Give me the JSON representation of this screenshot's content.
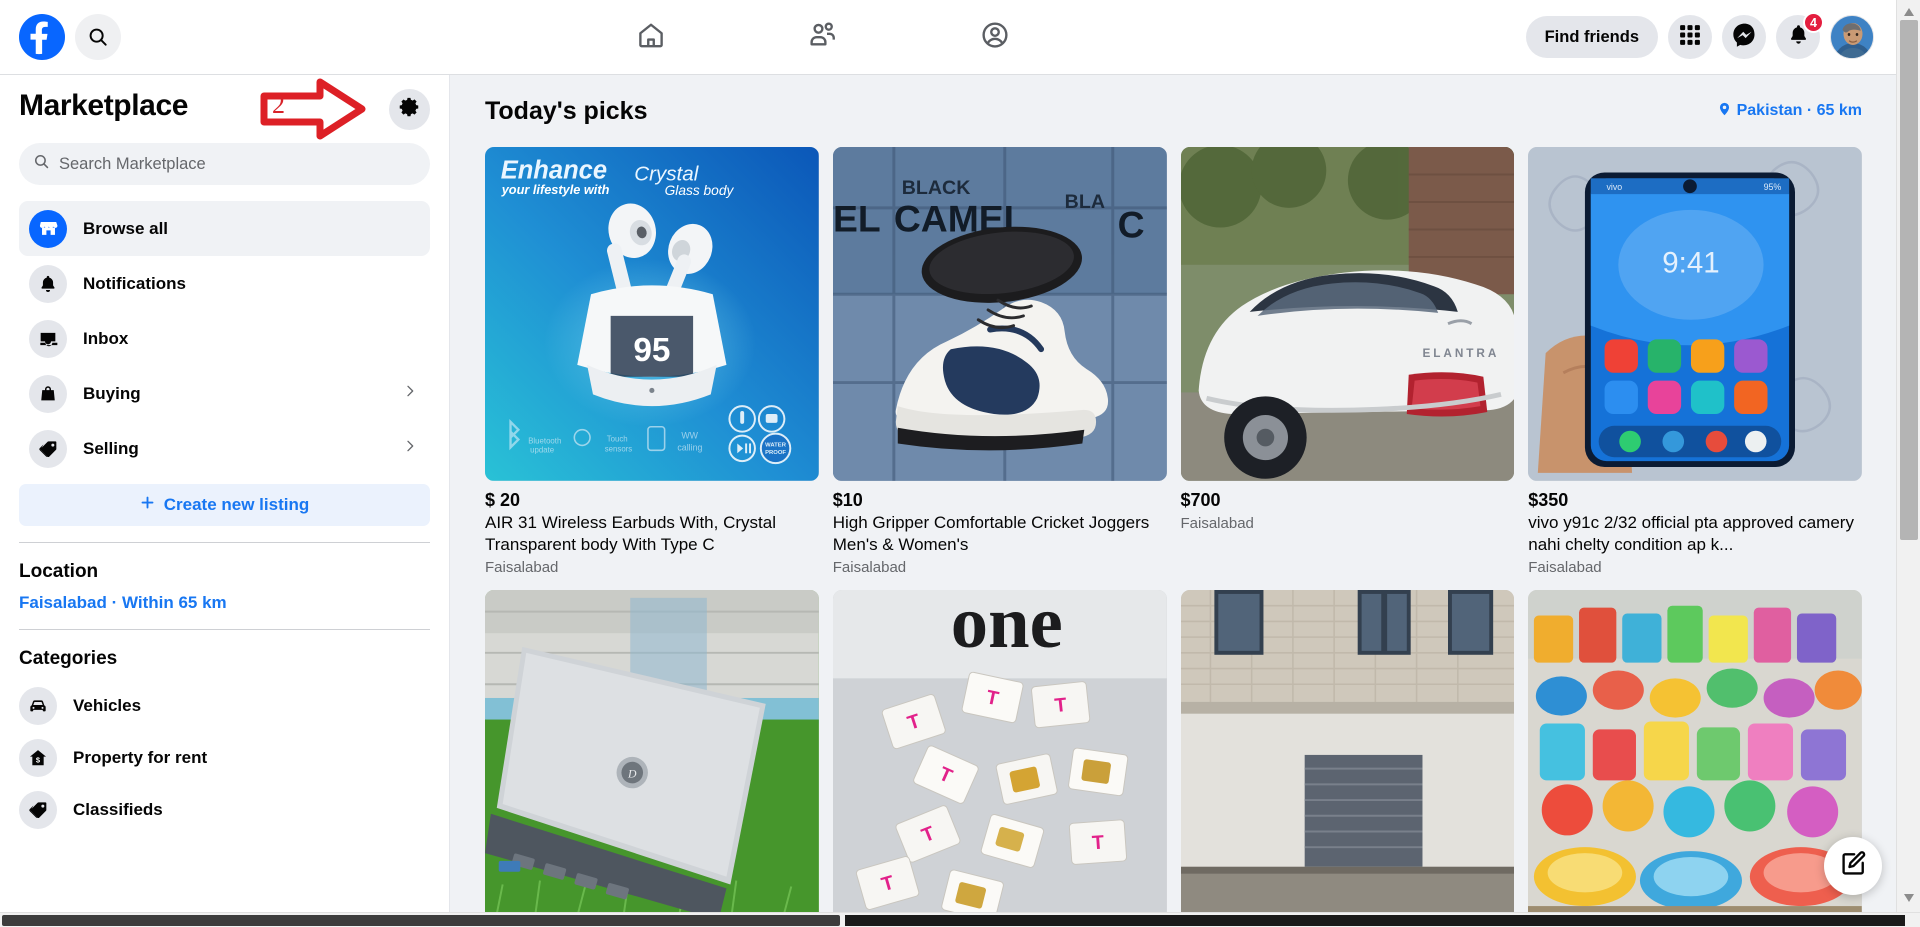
{
  "topbar": {
    "logo_icon": "facebook-logo-icon",
    "search_icon": "search-icon",
    "nav": [
      {
        "icon": "home-icon",
        "name": "home"
      },
      {
        "icon": "friends-icon",
        "name": "friends"
      },
      {
        "icon": "profile-icon",
        "name": "profile"
      }
    ],
    "find_friends_label": "Find friends",
    "menu_icon": "grid-menu-icon",
    "messenger_icon": "messenger-icon",
    "notifications_icon": "bell-icon",
    "notifications_badge": "4",
    "avatar_name": "user-avatar"
  },
  "sidebar": {
    "title": "Marketplace",
    "gear_icon": "gear-icon",
    "search": {
      "placeholder": "Search Marketplace",
      "value": "",
      "icon": "search-icon"
    },
    "nav_items": [
      {
        "label": "Browse all",
        "icon": "storefront-icon",
        "active": true,
        "chevron": false
      },
      {
        "label": "Notifications",
        "icon": "bell-icon",
        "active": false,
        "chevron": false
      },
      {
        "label": "Inbox",
        "icon": "inbox-icon",
        "active": false,
        "chevron": false
      },
      {
        "label": "Buying",
        "icon": "shopping-bag-icon",
        "active": false,
        "chevron": true
      },
      {
        "label": "Selling",
        "icon": "price-tag-icon",
        "active": false,
        "chevron": true
      }
    ],
    "create_listing_label": "Create new listing",
    "create_listing_icon": "plus-icon",
    "location_heading": "Location",
    "location_value": "Faisalabad · Within 65 km",
    "categories_heading": "Categories",
    "categories": [
      {
        "label": "Vehicles",
        "icon": "car-icon"
      },
      {
        "label": "Property for rent",
        "icon": "house-dollar-icon"
      },
      {
        "label": "Classifieds",
        "icon": "price-tag-icon"
      }
    ]
  },
  "main": {
    "heading": "Today's picks",
    "location_filter": {
      "label": "Pakistan · 65 km",
      "icon": "map-pin-icon"
    },
    "listings": [
      {
        "price": "$ 20",
        "name": "AIR 31 Wireless Earbuds With, Crystal Transparent body With Type C",
        "location": "Faisalabad",
        "image": "earbuds-promo",
        "image_text": {
          "line1": "Enhance",
          "line2": "your lifestyle with",
          "line3": "Crystal",
          "line4": "Glass body",
          "display": "95"
        }
      },
      {
        "price": "$10",
        "name": "High Gripper Comfortable Cricket Joggers Men's & Women's",
        "location": "Faisalabad",
        "image": "cricket-shoe"
      },
      {
        "price": "$700",
        "name": "",
        "location": "Faisalabad",
        "image": "white-car"
      },
      {
        "price": "$350",
        "name": "vivo y91c 2/32 official pta approved camery nahi chelty condition ap k...",
        "location": "Faisalabad",
        "image": "smartphone-in-hand"
      },
      {
        "price": "",
        "name": "",
        "location": "",
        "image": "dell-laptop"
      },
      {
        "price": "",
        "name": "",
        "location": "",
        "image": "sim-cards"
      },
      {
        "price": "",
        "name": "",
        "location": "",
        "image": "house-building"
      },
      {
        "price": "",
        "name": "",
        "location": "",
        "image": "plastic-kitchenware"
      }
    ]
  },
  "annotation": {
    "number": "2",
    "icon": "red-arrow-right",
    "color": "#d8232a"
  },
  "fab": {
    "icon": "compose-listing-icon"
  },
  "colors": {
    "brand_blue": "#0866ff",
    "link_blue": "#1877f2",
    "page_bg": "#f0f2f5",
    "panel_bg": "#ffffff",
    "badge_red": "#e41e3f",
    "annotation_red": "#d8232a",
    "text_primary": "#050505",
    "text_secondary": "#65676b"
  }
}
